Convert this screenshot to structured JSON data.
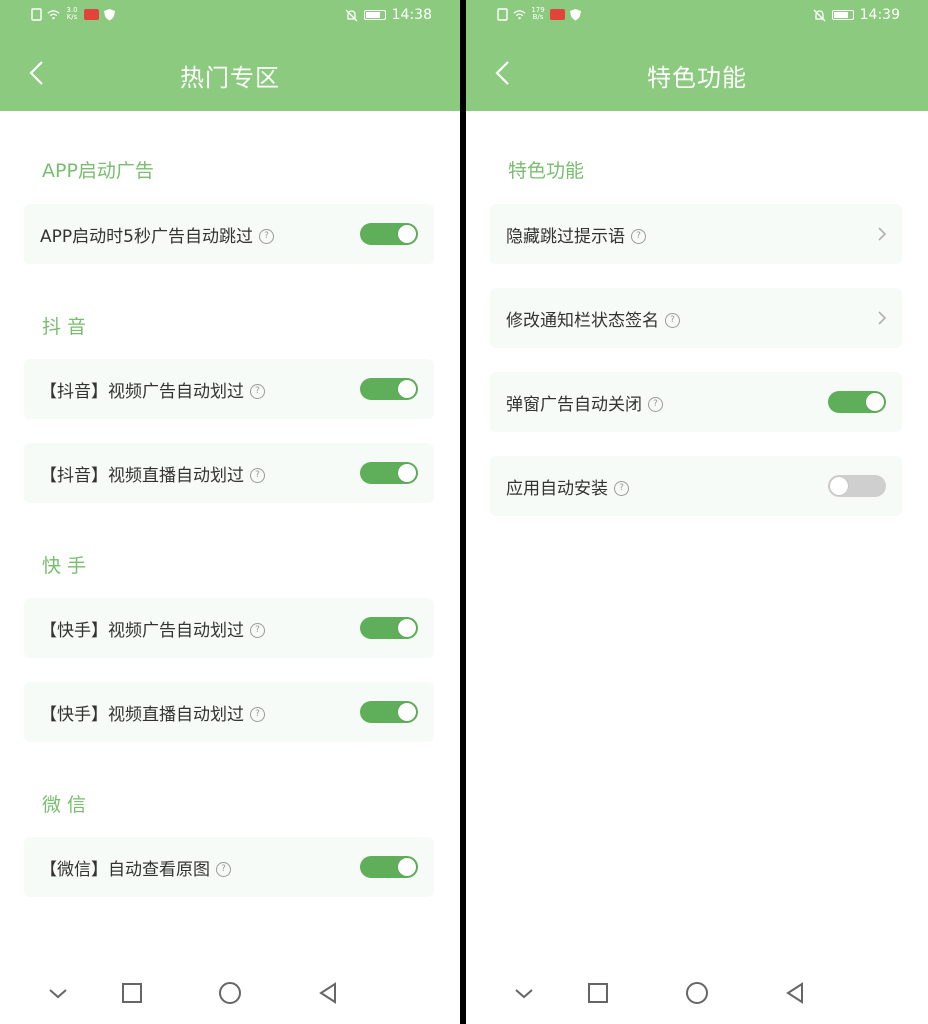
{
  "left": {
    "status": {
      "speed_top": "3.0",
      "speed_bottom": "K/s",
      "time": "14:38"
    },
    "title": "热门专区",
    "sections": [
      {
        "title": "APP启动广告",
        "items": [
          {
            "label": "APP启动时5秒广告自动跳过",
            "control": "toggle",
            "on": true
          }
        ]
      },
      {
        "title": "抖 音",
        "items": [
          {
            "label": "【抖音】视频广告自动划过",
            "control": "toggle",
            "on": true
          },
          {
            "label": "【抖音】视频直播自动划过",
            "control": "toggle",
            "on": true
          }
        ]
      },
      {
        "title": "快 手",
        "items": [
          {
            "label": "【快手】视频广告自动划过",
            "control": "toggle",
            "on": true
          },
          {
            "label": "【快手】视频直播自动划过",
            "control": "toggle",
            "on": true
          }
        ]
      },
      {
        "title": "微 信",
        "items": [
          {
            "label": "【微信】自动查看原图",
            "control": "toggle",
            "on": true
          }
        ]
      }
    ]
  },
  "right": {
    "status": {
      "speed_top": "179",
      "speed_bottom": "B/s",
      "time": "14:39"
    },
    "title": "特色功能",
    "sections": [
      {
        "title": "特色功能",
        "items": [
          {
            "label": "隐藏跳过提示语",
            "control": "chevron"
          },
          {
            "label": "修改通知栏状态签名",
            "control": "chevron"
          },
          {
            "label": "弹窗广告自动关闭",
            "control": "toggle",
            "on": true
          },
          {
            "label": "应用自动安装",
            "control": "toggle",
            "on": false
          }
        ]
      }
    ]
  },
  "help_glyph": "?",
  "icons": {
    "back": "chevron-left-icon",
    "chevron": "chevron-right-icon",
    "nav": [
      "collapse-down-icon",
      "recents-square-icon",
      "home-circle-icon",
      "back-triangle-icon"
    ]
  },
  "colors": {
    "primary": "#8ccb7f",
    "section_title": "#79bd6e",
    "toggle_on": "#5faf5a",
    "toggle_off": "#cfcfcf",
    "card_bg": "#f7fbf7"
  }
}
